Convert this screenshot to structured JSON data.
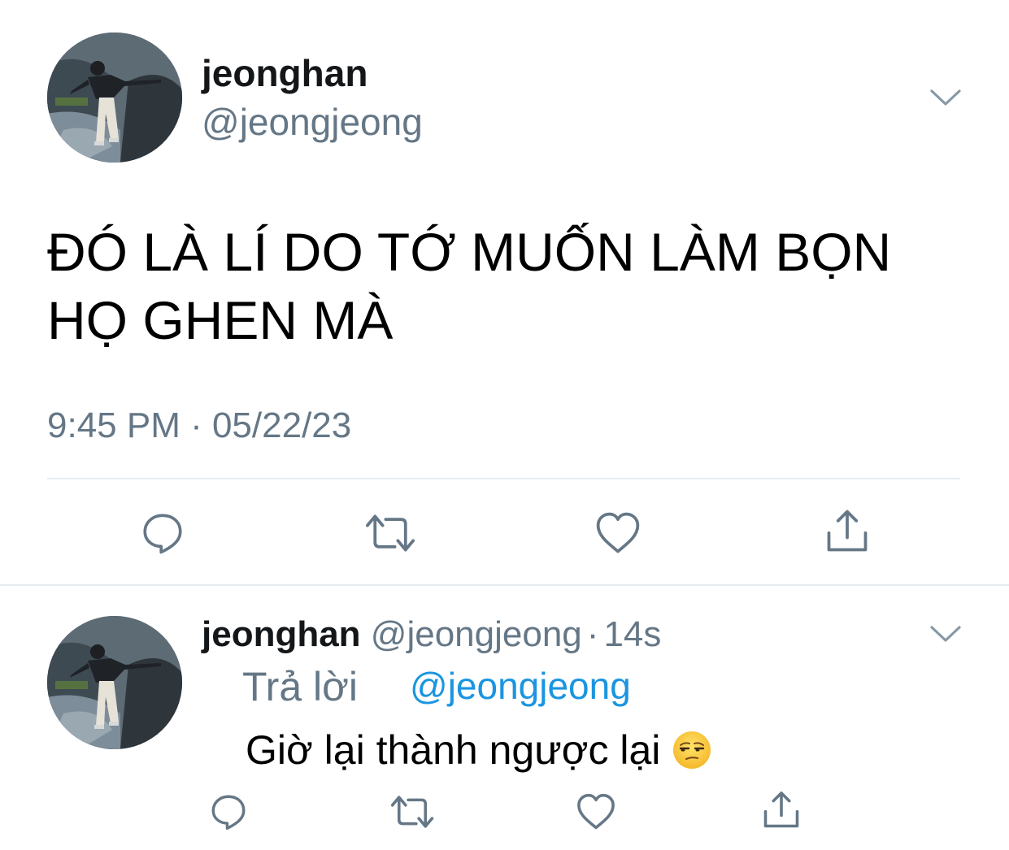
{
  "main_tweet": {
    "display_name": "jeonghan",
    "handle": "@jeongjeong",
    "text": "ĐÓ LÀ LÍ DO TỚ MUỐN LÀM BỌN HỌ GHEN MÀ",
    "timestamp": "9:45 PM · 05/22/23",
    "actions": [
      "reply-icon",
      "retweet-icon",
      "like-icon",
      "share-icon"
    ]
  },
  "reply_tweet": {
    "display_name": "jeonghan",
    "handle": "@jeongjeong",
    "separator": "·",
    "time": "14s",
    "reply_label": "Trả lời",
    "reply_to": "@jeongjeong",
    "text": "Giờ lại thành ngược lại",
    "emoji": "unamused-face-emoji",
    "actions": [
      "reply-icon",
      "retweet-icon",
      "like-icon",
      "share-icon"
    ]
  },
  "colors": {
    "primary_text": "#14171a",
    "secondary_text": "#657786",
    "link": "#1b95e0",
    "divider": "#e6ecf0",
    "icon": "#657786"
  }
}
